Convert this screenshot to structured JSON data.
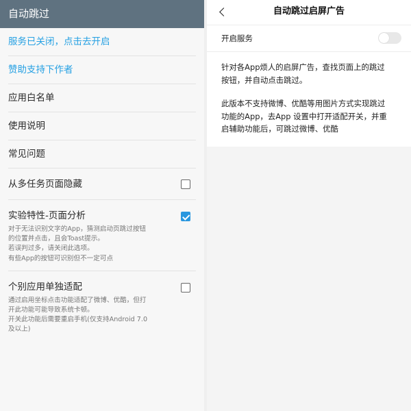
{
  "left": {
    "header_title": "自动跳过",
    "items": [
      {
        "label": "服务已关闭，点击去开启"
      },
      {
        "label": "赞助支持下作者"
      },
      {
        "label": "应用白名单"
      },
      {
        "label": "使用说明"
      },
      {
        "label": "常见问题"
      }
    ],
    "hide_recent": {
      "label": "从多任务页面隐藏",
      "checked": false
    },
    "page_analysis": {
      "label": "实验特性-页面分析",
      "checked": true,
      "desc": [
        "对于无法识别文字的App，猜测启动页跳过按钮",
        "的位置并点击，且会Toast提示。",
        "若误判过多，请关闭此选项。",
        "有些App的按钮可识别但不一定可点"
      ]
    },
    "single_app": {
      "label": "个别应用单独适配",
      "checked": false,
      "desc": [
        "通过启用坐标点击功能适配了微博、优酷，但打",
        "开此功能可能导致系统卡顿。",
        "开关此功能后需要重启手机(仅支持Android 7.0",
        "及以上)"
      ]
    }
  },
  "right": {
    "title": "自动跳过启屏广告",
    "service_label": "开启服务",
    "service_on": false,
    "info_para1": [
      "针对各App烦人的启屏广告，查找页面上的跳过",
      "按钮，并自动点击跳过。"
    ],
    "info_para2": [
      "此版本不支持微博、优酷等用图片方式实现跳过",
      "功能的App，去App 设置中打开适配开关，并重",
      "启辅助功能后，可跳过微博、优酷"
    ]
  },
  "colors": {
    "left_header_bg": "#5f7280",
    "link": "#27a1e3",
    "checkbox_checked": "#2a97df"
  }
}
